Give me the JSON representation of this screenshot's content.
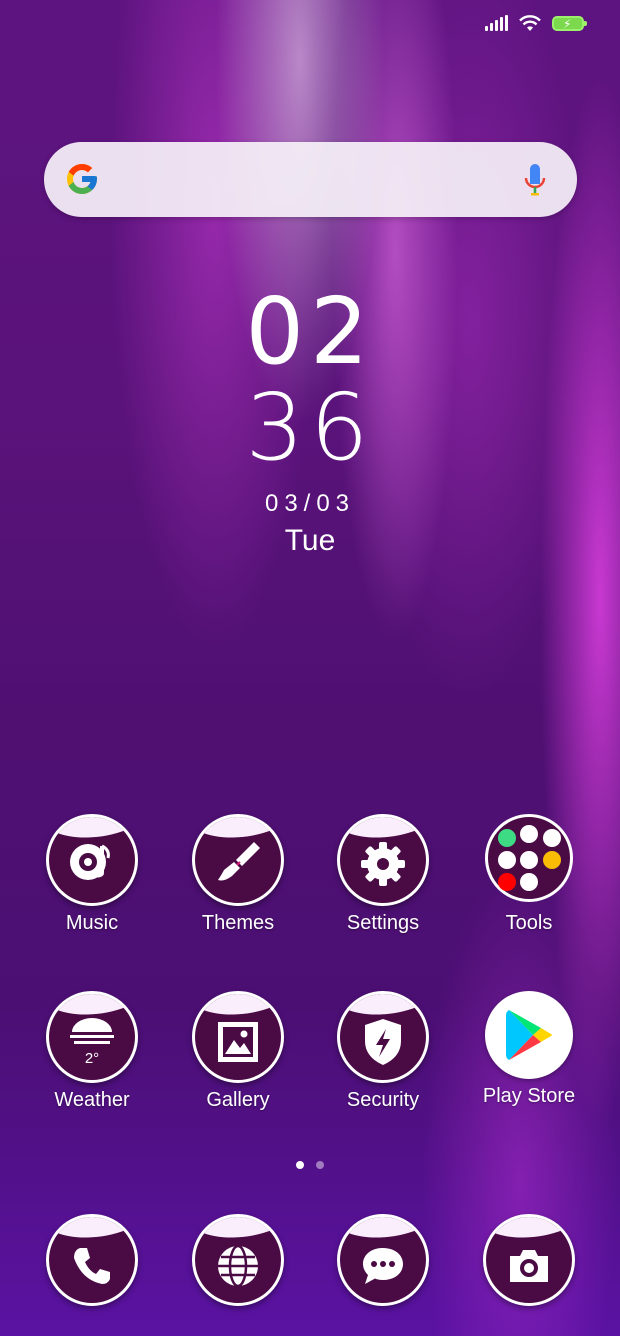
{
  "status_bar": {
    "icons": [
      "signal-icon",
      "wifi-icon",
      "battery-charging-icon"
    ],
    "battery_color": "#7cd94d"
  },
  "search": {
    "logo": "google-g-icon",
    "mic": "mic-icon"
  },
  "clock": {
    "hours": "02",
    "minutes": "36",
    "date": "03/03",
    "day": "Tue"
  },
  "home_apps": [
    {
      "label": "Music",
      "icon": "music-disc-icon"
    },
    {
      "label": "Themes",
      "icon": "paintbrush-icon"
    },
    {
      "label": "Settings",
      "icon": "gear-icon"
    },
    {
      "label": "Tools",
      "icon": "folder-icon"
    },
    {
      "label": "Weather",
      "icon": "weather-fog-icon",
      "temp": "2°"
    },
    {
      "label": "Gallery",
      "icon": "image-icon"
    },
    {
      "label": "Security",
      "icon": "shield-bolt-icon"
    },
    {
      "label": "Play Store",
      "icon": "play-store-icon"
    }
  ],
  "page_indicator": {
    "pages": 2,
    "active": 1
  },
  "dock": [
    {
      "name": "phone",
      "icon": "phone-icon"
    },
    {
      "name": "browser",
      "icon": "globe-icon"
    },
    {
      "name": "messages",
      "icon": "chat-bubble-icon"
    },
    {
      "name": "camera",
      "icon": "camera-icon"
    }
  ],
  "colors": {
    "icon_bg": "#4a0b45",
    "icon_cap": "#fbeefc",
    "accent_pink": "#d81b78"
  }
}
